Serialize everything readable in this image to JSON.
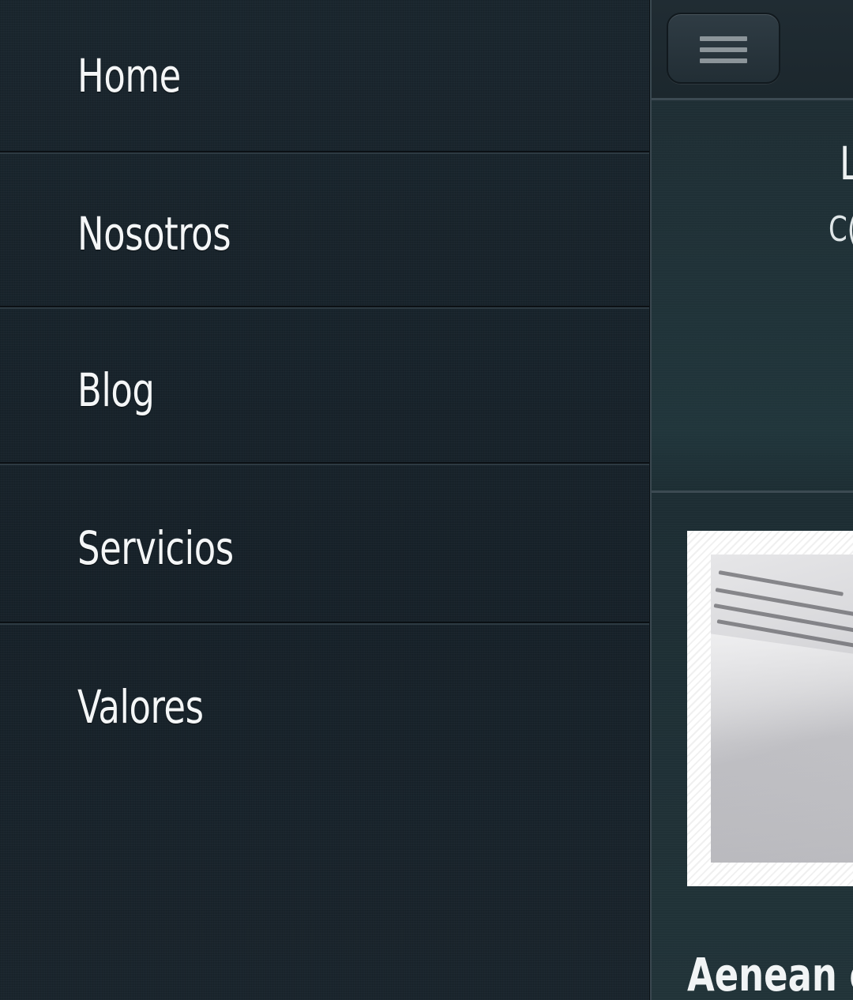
{
  "drawer": {
    "items": [
      {
        "label": "Home"
      },
      {
        "label": "Nosotros"
      },
      {
        "label": "Blog"
      },
      {
        "label": "Servicios"
      },
      {
        "label": "Valores"
      }
    ]
  },
  "header": {
    "menu_icon": "hamburger-menu-icon"
  },
  "hero": {
    "title": "L",
    "subtitle": "C("
  },
  "article": {
    "image_alt": "open-book-photo",
    "title": "Aenean co"
  },
  "colors": {
    "drawer_bg": "#18232b",
    "main_bg": "#1c2c32",
    "text": "#f4f6f7",
    "divider": "#0b1014"
  }
}
